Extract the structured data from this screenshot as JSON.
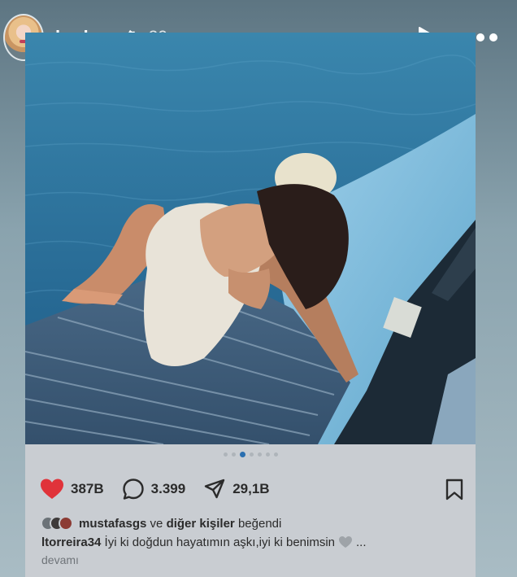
{
  "story": {
    "username": "hndsar",
    "verified": true,
    "time_ago": "20s",
    "icons": {
      "avatar": "profile-avatar",
      "verified": "verified-badge-icon",
      "play": "play-icon",
      "more": "more-options-icon"
    }
  },
  "post": {
    "photo_icon": "photo-couple-on-boat",
    "carousel": {
      "total_dots": 7,
      "active_index": 2
    },
    "actions": {
      "likes": "387B",
      "comments": "3.399",
      "shares": "29,1B"
    },
    "liked_by": {
      "user": "mustafasgs",
      "connector": "ve",
      "others": "diğer kişiler",
      "verb": "beğendi"
    },
    "caption": {
      "author": "ltorreira34",
      "text": "İyi ki doğdun hayatımın aşkı,iyi ki benimsin",
      "ellipsis": "...",
      "more": "devamı"
    }
  },
  "colors": {
    "like_red": "#e0333a",
    "active_dot": "#2a6fb0",
    "card_bg": "#c9cdd2"
  }
}
